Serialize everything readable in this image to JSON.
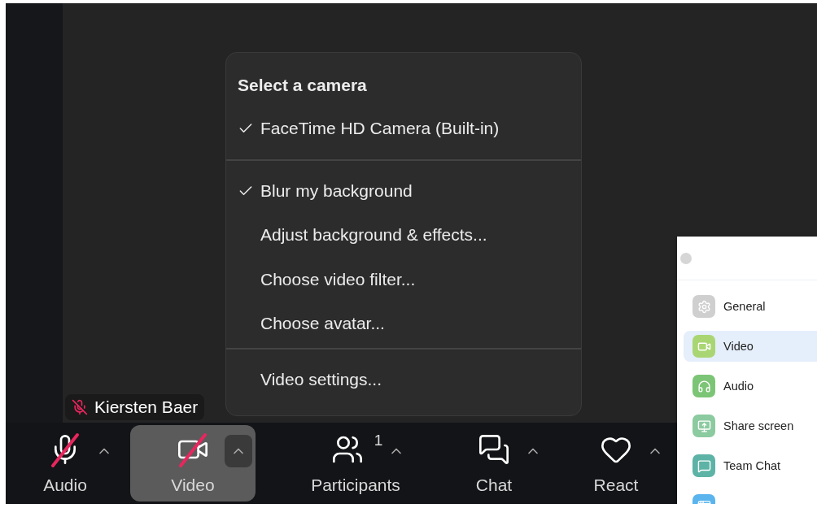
{
  "camera_menu": {
    "heading": "Select a camera",
    "sections": [
      {
        "items": [
          {
            "label": "FaceTime HD Camera (Built-in)",
            "checked": true
          }
        ]
      },
      {
        "items": [
          {
            "label": "Blur my background",
            "checked": true
          },
          {
            "label": "Adjust background & effects...",
            "checked": false
          },
          {
            "label": "Choose video filter...",
            "checked": false
          },
          {
            "label": "Choose avatar...",
            "checked": false
          }
        ]
      },
      {
        "items": [
          {
            "label": "Video settings...",
            "checked": false
          }
        ]
      }
    ]
  },
  "name_tag": {
    "name": "Kiersten Baer",
    "muted": true
  },
  "toolbar": [
    {
      "kind": "audio",
      "label": "Audio",
      "muted": true,
      "selected": false
    },
    {
      "kind": "video",
      "label": "Video",
      "muted": true,
      "selected": true
    },
    {
      "kind": "participants",
      "label": "Participants",
      "count": "1",
      "selected": false
    },
    {
      "kind": "chat",
      "label": "Chat",
      "selected": false
    },
    {
      "kind": "react",
      "label": "React",
      "selected": false
    }
  ],
  "settings_sidebar": [
    {
      "kind": "general",
      "label": "General",
      "color": "#cfcfcf",
      "selected": false
    },
    {
      "kind": "video",
      "label": "Video",
      "color": "#a9d673",
      "selected": true
    },
    {
      "kind": "audio",
      "label": "Audio",
      "color": "#7cc576",
      "selected": false
    },
    {
      "kind": "share",
      "label": "Share screen",
      "color": "#8ccaa0",
      "selected": false
    },
    {
      "kind": "chat",
      "label": "Team Chat",
      "color": "#5db3a6",
      "selected": false
    },
    {
      "kind": "apps",
      "color": "#5ab4ee",
      "selected": false
    }
  ]
}
